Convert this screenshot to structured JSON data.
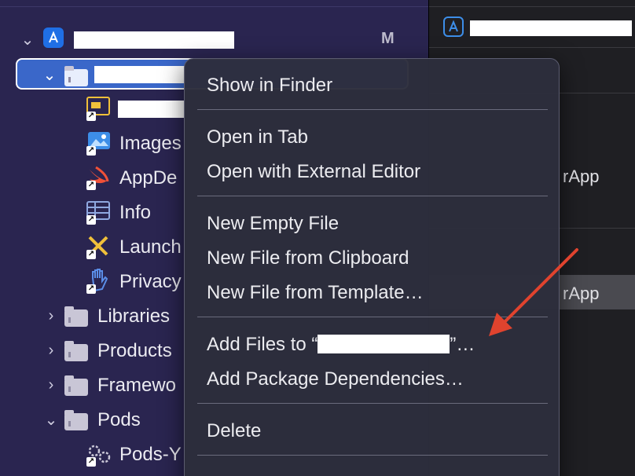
{
  "navigator": {
    "project": {
      "badge": "M"
    },
    "items": [
      {
        "label": "Images"
      },
      {
        "label": "AppDe"
      },
      {
        "label": "Info"
      },
      {
        "label": "Launch"
      },
      {
        "label": "Privacy"
      },
      {
        "label": "Libraries"
      },
      {
        "label": "Products"
      },
      {
        "label": "Framewo"
      },
      {
        "label": "Pods"
      },
      {
        "label": "Pods-Y"
      }
    ]
  },
  "inspector": {
    "rows": [
      {
        "label": "rApp"
      },
      {
        "label": "rApp"
      }
    ]
  },
  "context_menu": {
    "show_in_finder": "Show in Finder",
    "open_in_tab": "Open in Tab",
    "open_with_external_editor": "Open with External Editor",
    "new_empty_file": "New Empty File",
    "new_file_from_clipboard": "New File from Clipboard",
    "new_file_from_template": "New File from Template…",
    "add_files_prefix": "Add Files to “",
    "add_files_suffix": "”…",
    "add_package_dependencies": "Add Package Dependencies…",
    "delete": "Delete"
  },
  "colors": {
    "navigator_bg": "#2a2550",
    "selection": "#3a67c9",
    "arrow": "#e0432e"
  }
}
